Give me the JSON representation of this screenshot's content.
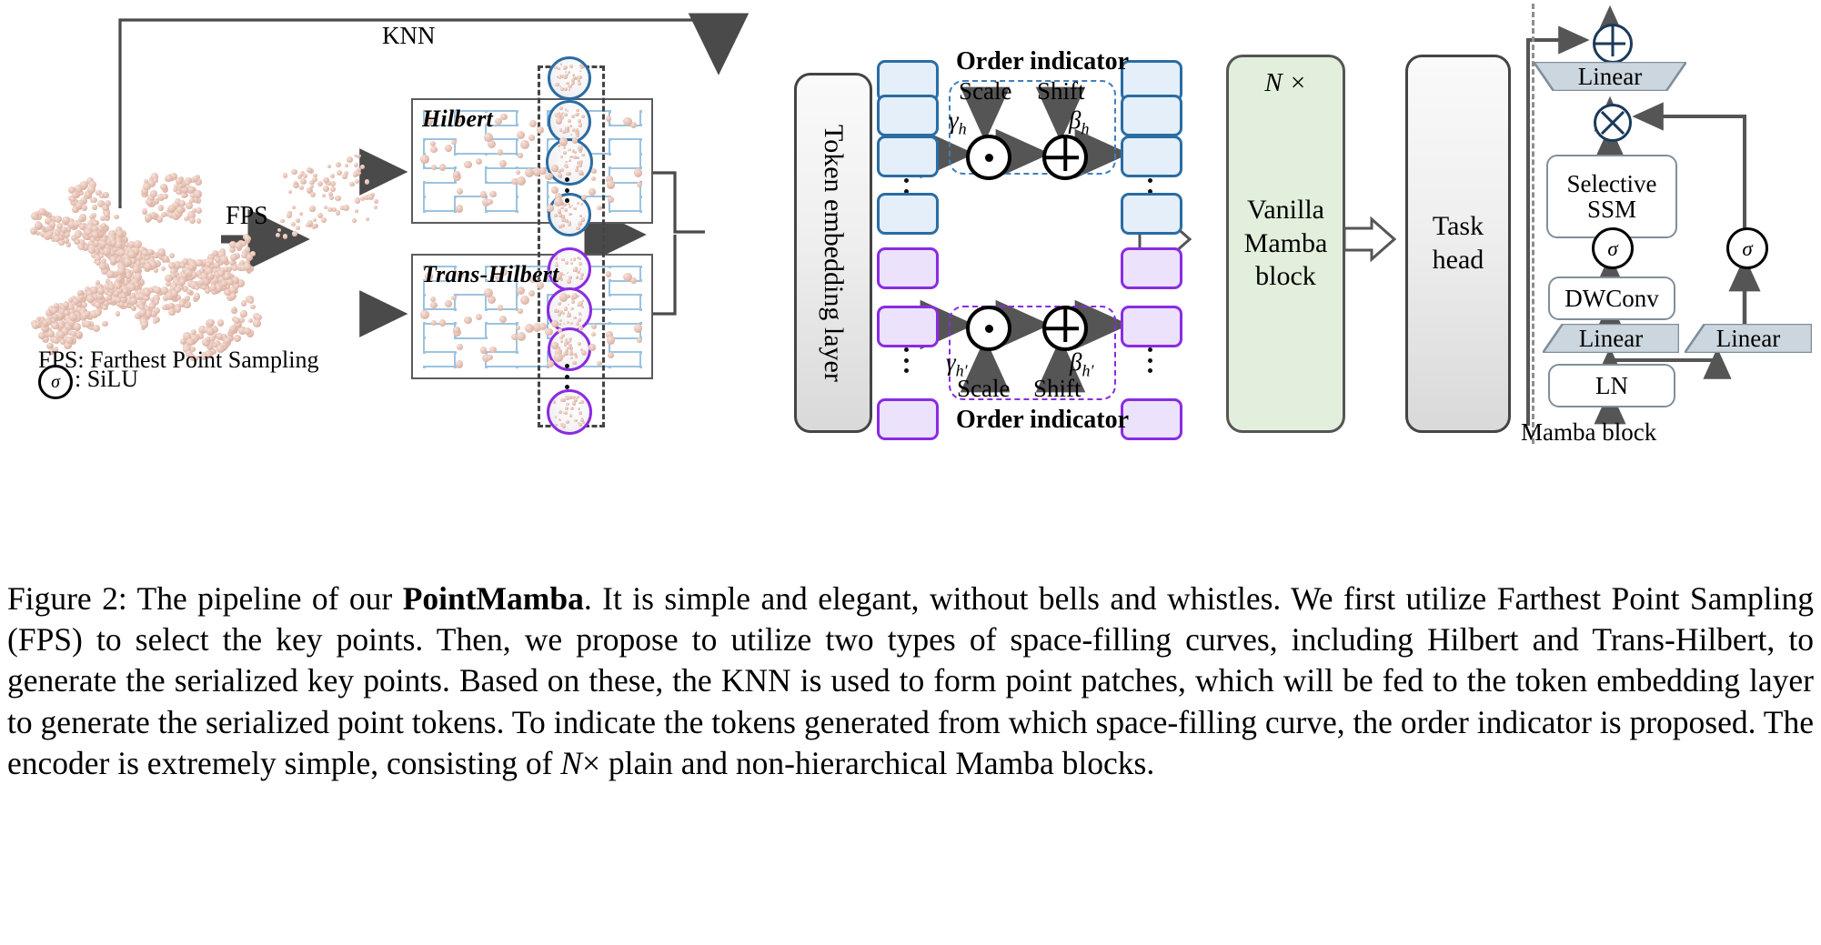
{
  "figure": {
    "label": "Figure 2:",
    "caption_html": "Figure 2: The pipeline of our <b>PointMamba</b>. It is simple and elegant, without bells and whistles. We first utilize Farthest Point Sampling (FPS) to select the key points. Then, we propose to utilize two types of space-filling curves, including Hilbert and Trans-Hilbert, to generate the serialized key points. Based on these, the KNN is used to form point patches, which will be fed to the token embedding layer to generate the serialized point tokens. To indicate the tokens generated from which space-filling curve, the order indicator is proposed. The encoder is extremely simple, consisting of <i>N</i>&#215; plain and non-hierarchical Mamba blocks.",
    "caption_plain": "Figure 2: The pipeline of our PointMamba. It is simple and elegant, without bells and whistles. We first utilize Farthest Point Sampling (FPS) to select the key points. Then, we propose to utilize two types of space-filling curves, including Hilbert and Trans-Hilbert, to generate the serialized key points. Based on these, the KNN is used to form point patches, which will be fed to the token embedding layer to generate the serialized point tokens. To indicate the tokens generated from which space-filling curve, the order indicator is proposed. The encoder is extremely simple, consisting of N× plain and non-hierarchical Mamba blocks."
  },
  "pipeline": {
    "knn_label": "KNN",
    "fps_label": "FPS",
    "legend_fps": "FPS: Farthest Point Sampling",
    "legend_sigma_symbol": "σ",
    "legend_sigma_text": ": SiLU",
    "curve_panels": [
      {
        "title": "Hilbert"
      },
      {
        "title": "Trans-Hilbert"
      }
    ],
    "token_embedding_label": "Token embedding layer",
    "encoder": {
      "repeat_label": "N ×",
      "title_line1": "Vanilla",
      "title_line2": "Mamba",
      "title_line3": "block"
    },
    "task_head": {
      "line1": "Task",
      "line2": "head"
    }
  },
  "order_indicator_top": {
    "title": "Order indicator",
    "scale_label": "Scale",
    "shift_label": "Shift",
    "gamma": "γ",
    "gamma_sub": "h",
    "beta": "β",
    "beta_sub": "h",
    "mul_symbol": "⊙",
    "add_symbol": "⊕"
  },
  "order_indicator_bottom": {
    "title": "Order indicator",
    "scale_label": "Scale",
    "shift_label": "Shift",
    "gamma": "γ",
    "gamma_sub": "h′",
    "beta": "β",
    "beta_sub": "h′",
    "mul_symbol": "⊙",
    "add_symbol": "⊕"
  },
  "mamba_block": {
    "caption": "Mamba block",
    "add_symbol": "⊕",
    "mul_symbol": "⊗",
    "linear_out": "Linear",
    "selective_ssm_line1": "Selective",
    "selective_ssm_line2": "SSM",
    "sigma_left": "σ",
    "sigma_right": "σ",
    "dwconv": "DWConv",
    "linear_left": "Linear",
    "linear_right": "Linear",
    "ln": "LN"
  },
  "colors": {
    "hilbert_token_border": "#2b6ca3",
    "hilbert_token_fill": "#e4eff9",
    "trans_hilbert_token_border": "#8a2be2",
    "trans_hilbert_token_fill": "#ece2fb",
    "encoder_fill": "#e2efdc",
    "curve_line": "#9cc3e0",
    "point_color": "#e4bfb2",
    "arrow_grey": "#555555",
    "mamba_shape_fill": "#ccd6de"
  }
}
